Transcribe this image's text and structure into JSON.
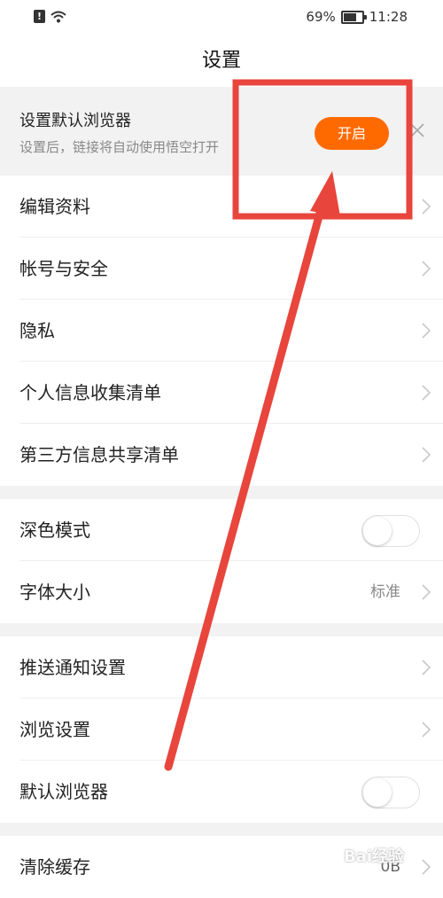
{
  "status_bar": {
    "battery": "69%",
    "battery_level": 0.69,
    "time": "11:28"
  },
  "header": {
    "title": "设置"
  },
  "banner": {
    "title": "设置默认浏览器",
    "description": "设置后，链接将自动使用悟空打开",
    "button_label": "开启"
  },
  "groups": [
    {
      "rows": [
        {
          "label": "编辑资料"
        },
        {
          "label": "帐号与安全"
        },
        {
          "label": "隐私"
        },
        {
          "label": "个人信息收集清单"
        },
        {
          "label": "第三方信息共享清单"
        }
      ]
    },
    {
      "rows": [
        {
          "label": "深色模式",
          "toggle": false
        },
        {
          "label": "字体大小",
          "value": "标准"
        }
      ]
    },
    {
      "rows": [
        {
          "label": "推送通知设置"
        },
        {
          "label": "浏览设置"
        },
        {
          "label": "默认浏览器",
          "toggle": false
        }
      ]
    },
    {
      "rows": [
        {
          "label": "清除缓存",
          "value": "0B"
        }
      ]
    }
  ],
  "colors": {
    "accent": "#ff6a00",
    "annotation": "#e8453c"
  }
}
